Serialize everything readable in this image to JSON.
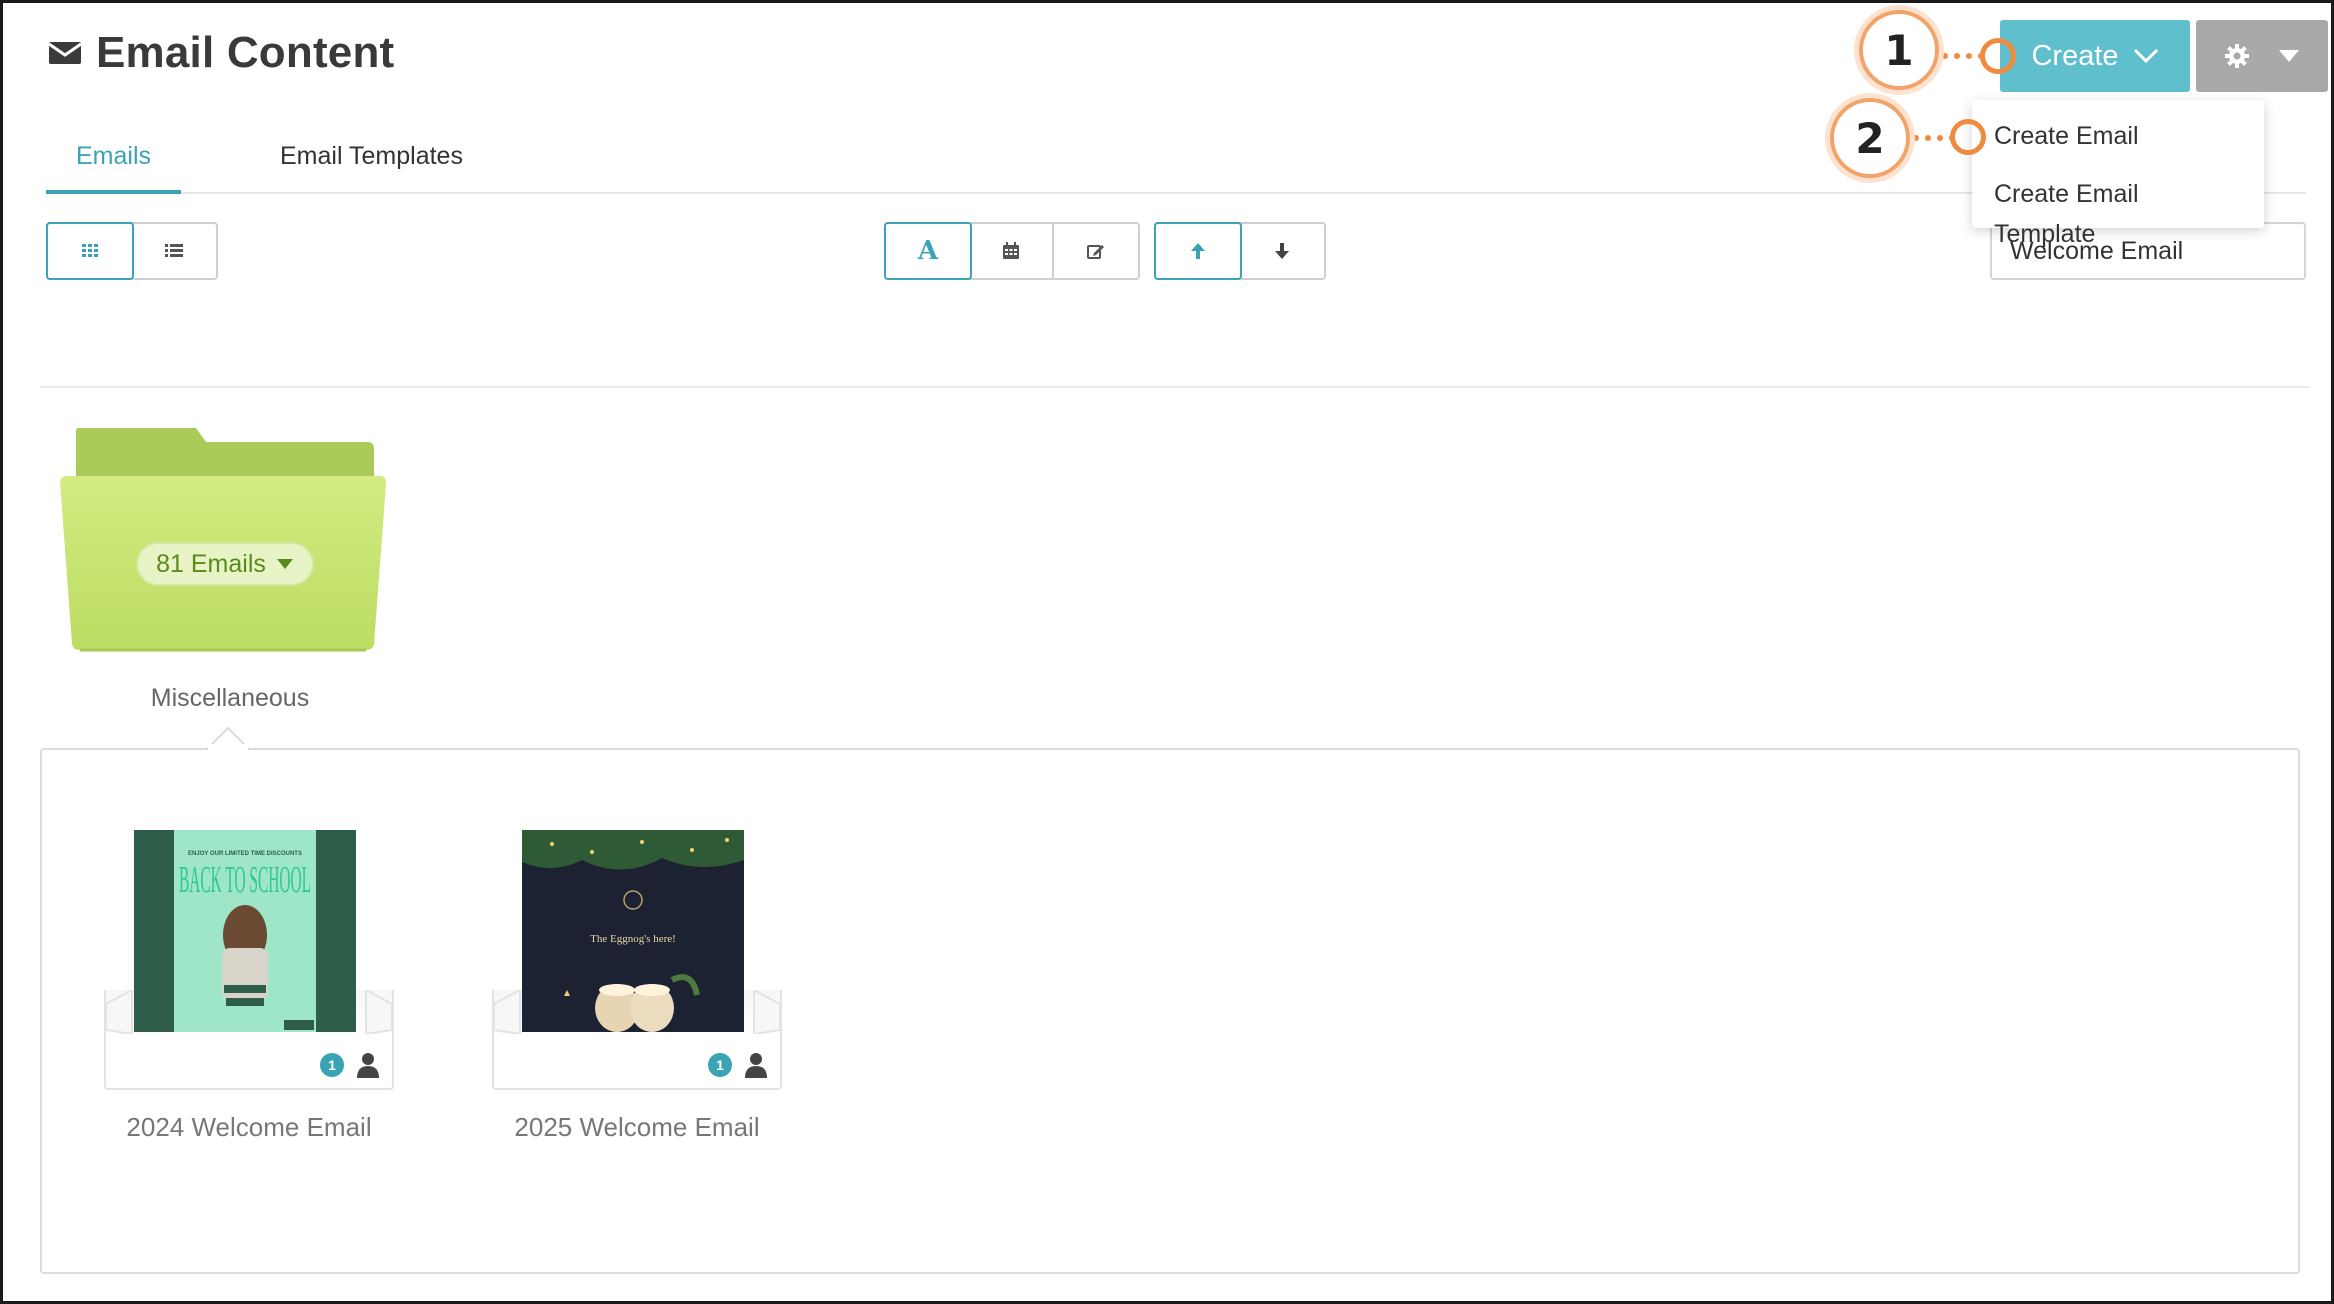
{
  "header": {
    "title": "Email Content",
    "icon": "envelope-icon"
  },
  "tabs": [
    {
      "label": "Emails",
      "active": true
    },
    {
      "label": "Email Templates",
      "active": false
    }
  ],
  "toolbar": {
    "view_buttons": [
      "grid-view-icon",
      "list-view-icon"
    ],
    "sort_buttons": [
      "alpha-sort-icon",
      "calendar-icon",
      "edit-icon"
    ],
    "direction_buttons": [
      "arrow-up-icon",
      "arrow-down-icon"
    ],
    "sort_letter": "A",
    "search_value": "Welcome Email"
  },
  "create": {
    "label": "Create",
    "menu": [
      "Create Email",
      "Create Email Template"
    ]
  },
  "callouts": [
    "1",
    "2"
  ],
  "folder": {
    "name": "Miscellaneous",
    "badge": "81 Emails",
    "color": "#c4e26f"
  },
  "emails": [
    {
      "title": "2024 Welcome Email",
      "count": "1",
      "thumb_header": "ENJOY OUR LIMITED TIME DISCOUNTS",
      "thumb_big": "BACK TO SCHOOL"
    },
    {
      "title": "2025 Welcome Email",
      "count": "1",
      "thumb_text": "The Eggnog's here!"
    }
  ],
  "colors": {
    "accent": "#3aa3b5",
    "create_button": "#5fbfcc",
    "settings_button": "#a9a9a9",
    "callout": "#f08a3e"
  }
}
